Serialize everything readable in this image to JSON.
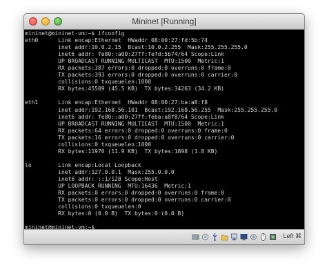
{
  "window": {
    "title": "Mininet [Running]"
  },
  "terminal": {
    "lines": [
      "mininet@mininet-vm:~$ ifconfig",
      "eth0      Link encap:Ethernet  HWaddr 08:00:27:fd:5b:74",
      "          inet addr:10.0.2.15  Bcast:10.0.2.255  Mask:255.255.255.0",
      "          inet6 addr: fe80::a00:27ff:fefd:5b74/64 Scope:Link",
      "          UP BROADCAST RUNNING MULTICAST  MTU:1500  Metric:1",
      "          RX packets:387 errors:0 dropped:0 overruns:0 frame:0",
      "          TX packets:393 errors:0 dropped:0 overruns:0 carrier:0",
      "          collisions:0 txqueuelen:1000",
      "          RX bytes:45509 (45.5 KB)  TX bytes:34263 (34.2 KB)",
      "",
      "eth1      Link encap:Ethernet  HWaddr 08:00:27:ba:a8:f8",
      "          inet addr:192.168.56.101  Bcast:192.168.56.255  Mask:255.255.255.0",
      "          inet6 addr: fe80::a00:27ff:feba:a8f8/64 Scope:Link",
      "          UP BROADCAST RUNNING MULTICAST  MTU:1500  Metric:1",
      "          RX packets:64 errors:0 dropped:0 overruns:0 frame:0",
      "          TX packets:16 errors:0 dropped:0 overruns:0 carrier:0",
      "          collisions:0 txqueuelen:1000",
      "          RX bytes:11970 (11.9 KB)  TX bytes:1898 (1.8 KB)",
      "",
      "lo        Link encap:Local Loopback",
      "          inet addr:127.0.0.1  Mask:255.0.0.0",
      "          inet6 addr: ::1/128 Scope:Host",
      "          UP LOOPBACK RUNNING  MTU:16436  Metric:1",
      "          RX packets:0 errors:0 dropped:0 overruns:0 frame:0",
      "          TX packets:0 errors:0 dropped:0 overruns:0 carrier:0",
      "          collisions:0 txqueuelen:0",
      "          RX bytes:0 (0.0 B)  TX bytes:0 (0.0 B)",
      "",
      "mininet@mininet-vm:~$ _"
    ]
  },
  "statusbar": {
    "host_key_label": "Left ⌘",
    "icons": [
      "hard-disk-icon",
      "optical-drive-icon",
      "usb-icon",
      "shared-folders-icon",
      "network-icon",
      "display-icon",
      "recording-icon",
      "mouse-integration-icon",
      "cpu-activity-icon"
    ]
  },
  "colors": {
    "terminal_bg": "#000000",
    "terminal_fg": "#d6d6d6",
    "close": "#e0443e",
    "minimize": "#dea123",
    "maximize": "#3ea43a"
  }
}
